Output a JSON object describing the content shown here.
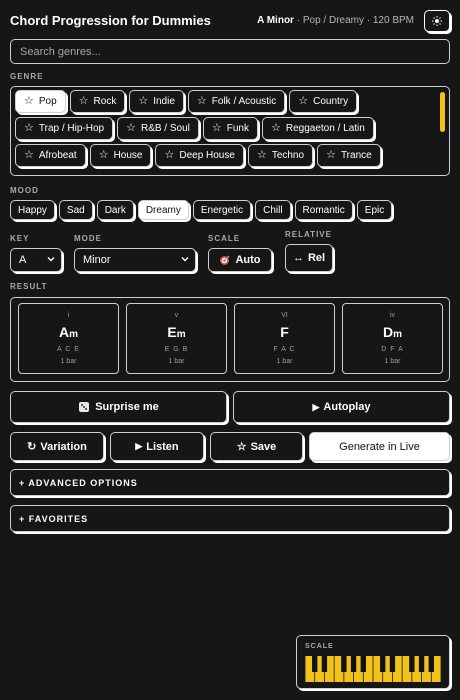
{
  "header": {
    "title": "Chord Progression for Dummies",
    "key_display": "A Minor",
    "info": " · Pop / Dreamy · 120 BPM",
    "theme_icon": "sun-icon"
  },
  "search": {
    "placeholder": "Search genres...",
    "value": ""
  },
  "genre": {
    "label": "GENRE",
    "rows": [
      [
        "Pop",
        "Rock",
        "Indie",
        "Folk / Acoustic",
        "Country"
      ],
      [
        "Trap / Hip-Hop",
        "R&B / Soul",
        "Funk",
        "Reggaeton / Latin"
      ],
      [
        "Afrobeat",
        "House",
        "Deep House",
        "Techno",
        "Trance"
      ]
    ],
    "selected": "Pop",
    "accent_color": "#f2c21b"
  },
  "mood": {
    "label": "MOOD",
    "items": [
      "Happy",
      "Sad",
      "Dark",
      "Dreamy",
      "Energetic",
      "Chill",
      "Romantic",
      "Epic"
    ],
    "selected": "Dreamy"
  },
  "key": {
    "label": "KEY",
    "value": "A"
  },
  "mode": {
    "label": "MODE",
    "value": "Minor"
  },
  "scale": {
    "label": "SCALE",
    "button": "Auto"
  },
  "relative": {
    "label": "RELATIVE",
    "button": "Rel"
  },
  "result": {
    "label": "RESULT",
    "chords": [
      {
        "roman": "i",
        "root": "A",
        "quality": "m",
        "notes": "A C E",
        "bars": "1 bar"
      },
      {
        "roman": "v",
        "root": "E",
        "quality": "m",
        "notes": "E G B",
        "bars": "1 bar"
      },
      {
        "roman": "VI",
        "root": "F",
        "quality": "",
        "notes": "F A C",
        "bars": "1 bar"
      },
      {
        "roman": "iv",
        "root": "D",
        "quality": "m",
        "notes": "D F A",
        "bars": "1 bar"
      }
    ]
  },
  "actions": {
    "surprise": "Surprise me",
    "autoplay": "Autoplay",
    "variation": "Variation",
    "listen": "Listen",
    "save": "Save",
    "generate_live": "Generate in Live"
  },
  "advanced": "+ ADVANCED OPTIONS",
  "favorites": "+ FAVORITES",
  "scale_preview": {
    "label": "SCALE",
    "key_color": "#f2c21b",
    "black_key_color": "#111111"
  }
}
